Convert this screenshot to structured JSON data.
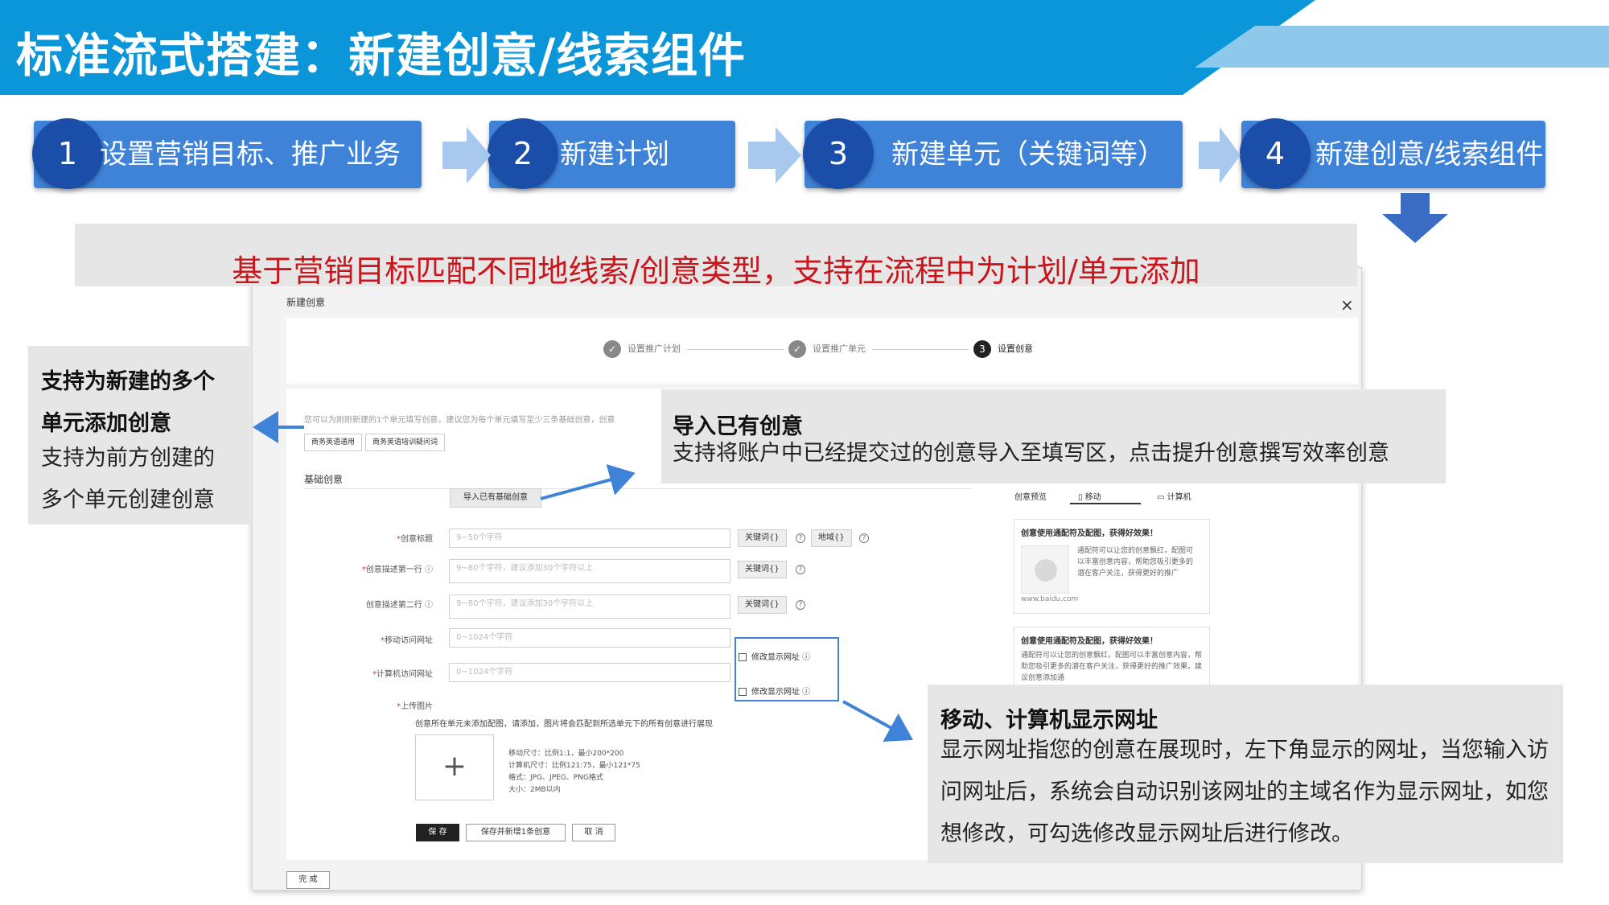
{
  "slide": {
    "title": "标准流式搭建：新建创意/线索组件",
    "banner": "基于营销目标匹配不同地线索/创意类型，支持在流程中为计划/单元添加"
  },
  "colors": {
    "title_bg": "#0a96d8",
    "step_bg": "#3f83d9",
    "step_num_bg": "#1b4ea8",
    "banner_text": "#c8161d",
    "highlight": "#3f83d9"
  },
  "steps": [
    {
      "num": "1",
      "label": "设置营销目标、推广业务"
    },
    {
      "num": "2",
      "label": "新建计划"
    },
    {
      "num": "3",
      "label": "新建单元（关键词等）"
    },
    {
      "num": "4",
      "label": "新建创意/线索组件"
    }
  ],
  "dialog": {
    "title": "新建创意",
    "close": "×",
    "progress": [
      {
        "mark": "✓",
        "label": "设置推广计划"
      },
      {
        "mark": "✓",
        "label": "设置推广单元"
      },
      {
        "mark": "3",
        "label": "设置创意"
      }
    ],
    "hint": "您可以为刚刚新建的1个单元填写创意，建议您为每个单元填写至少三条基础创意，创意",
    "unit_tabs": [
      "商务英语通用",
      "商务英语培训疑问词"
    ],
    "section": "基础创意",
    "import_button": "导入已有基础创意",
    "fields": {
      "title": {
        "label": "创意标题",
        "placeholder": "9~50个字符",
        "btn1": "关键词{}",
        "btn2": "地域{}"
      },
      "desc1": {
        "label": "创意描述第一行",
        "placeholder": "9~80个字符，建议添加30个字符以上",
        "btn1": "关键词{}"
      },
      "desc2": {
        "label": "创意描述第二行",
        "placeholder": "9~80个字符，建议添加30个字符以上",
        "btn1": "关键词{}"
      },
      "mobile_url": {
        "label": "移动访问网址",
        "placeholder": "0~1024个字符",
        "check": "修改显示网址"
      },
      "pc_url": {
        "label": "计算机访问网址",
        "placeholder": "0~1024个字符",
        "check": "修改显示网址"
      },
      "image": {
        "label": "上传图片",
        "desc": "创意所在单元未添加配图，请添加，图片将会匹配到所选单元下的所有创意进行展现",
        "plus": "+"
      }
    },
    "upload_spec": [
      "移动尺寸：比例1:1，最小200*200",
      "计算机尺寸：比例121:75，最小121*75",
      "格式：JPG、JPEG、PNG格式",
      "大小：2MB以内"
    ],
    "buttons": {
      "save": "保 存",
      "save_new": "保存并新增1条创意",
      "cancel": "取 消",
      "done": "完 成"
    },
    "preview": {
      "label": "创意预览",
      "tab_mobile": "移动",
      "tab_pc": "计算机",
      "card1_title": "创意使用通配符及配图，获得好效果！",
      "card1_text": "通配符可以让您的创意飘红，配图可以丰富创意内容，帮助您吸引更多的潜在客户关注，获得更好的推广",
      "card1_url": "www.baidu.com",
      "card2_title": "创意使用通配符及配图，获得好效果！",
      "card2_text": "通配符可以让您的创意飘红，配图可以丰富创意内容，帮助您吸引更多的潜在客户关注，获得更好的推广效果，建议创意添加通"
    }
  },
  "callouts": {
    "left": {
      "title1": "支持为新建的多个",
      "title2": "单元添加创意",
      "text1": "支持为前方创建的",
      "text2": "多个单元创建创意"
    },
    "import": {
      "title": "导入已有创意",
      "text": "支持将账户中已经提交过的创意导入至填写区，点击提升创意撰写效率创意"
    },
    "url": {
      "title": "移动、计算机显示网址",
      "text": "显示网址指您的创意在展现时，左下角显示的网址，当您输入访问网址后，系统会自动识别该网址的主域名作为显示网址，如您想修改，可勾选修改显示网址后进行修改。"
    }
  }
}
